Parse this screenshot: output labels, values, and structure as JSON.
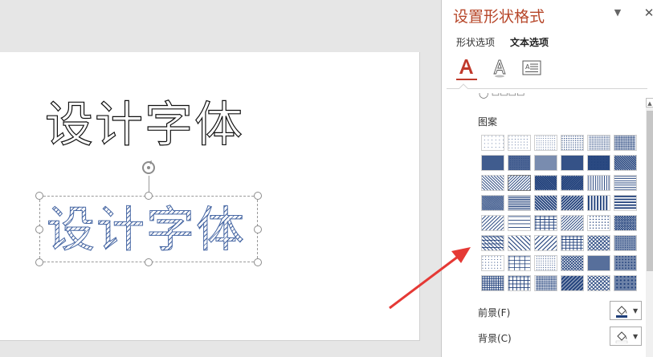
{
  "slide": {
    "title_outline": "设计字体",
    "title_pattern": "设计字体"
  },
  "format_pane": {
    "title": "设置形状格式",
    "menu_icon": "chevron-down-icon",
    "close_icon": "close-icon",
    "tabs": [
      {
        "label": "形状选项",
        "active": false
      },
      {
        "label": "文本选项",
        "active": true
      }
    ],
    "icon_tabs": [
      {
        "icon": "text-fill-outline-icon",
        "active": true
      },
      {
        "icon": "text-effects-icon",
        "active": false
      },
      {
        "icon": "textbox-icon",
        "active": false
      }
    ],
    "pattern_section": {
      "label": "图案",
      "selected_index": 13
    },
    "foreground": {
      "label": "前景(F)",
      "color": "#1f3f7a",
      "icon": "paint-bucket-icon"
    },
    "background": {
      "label": "背景(C)",
      "color": "#ffffff",
      "icon": "paint-bucket-icon"
    }
  },
  "colors": {
    "pane_title": "#b7472a",
    "pattern_ink": "#1f3f7a",
    "annotation_arrow": "#e53935"
  }
}
